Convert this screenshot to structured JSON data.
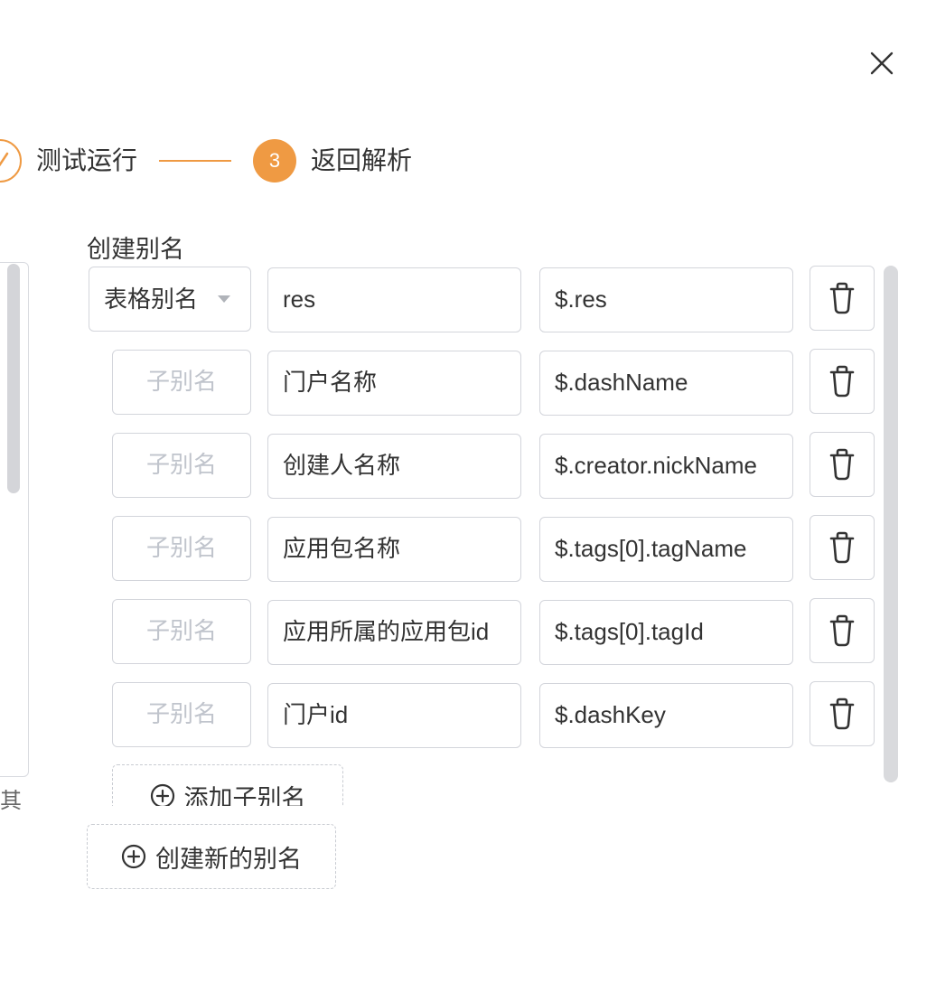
{
  "steps": {
    "done_label": "测试运行",
    "active_number": "3",
    "active_label": "返回解析"
  },
  "left_panel": {
    "truncated_text": "其"
  },
  "section": {
    "title": "创建别名"
  },
  "main_row": {
    "type_select": "表格别名",
    "name": "res",
    "path": "$.res"
  },
  "sub_rows": [
    {
      "alias_placeholder": "子别名",
      "name": "门户名称",
      "path": "$.dashName"
    },
    {
      "alias_placeholder": "子别名",
      "name": "创建人名称",
      "path": "$.creator.nickName"
    },
    {
      "alias_placeholder": "子别名",
      "name": "应用包名称",
      "path": "$.tags[0].tagName"
    },
    {
      "alias_placeholder": "子别名",
      "name": "应用所属的应用包id",
      "path": "$.tags[0].tagId"
    },
    {
      "alias_placeholder": "子别名",
      "name": "门户id",
      "path": "$.dashKey"
    }
  ],
  "actions": {
    "add_sub_alias": "添加子别名",
    "create_new_alias": "创建新的别名"
  },
  "colors": {
    "accent": "#ef9a43",
    "border": "#d3d5db",
    "placeholder": "#c0c4cc"
  },
  "icons": {
    "close": "close-icon",
    "check": "check-icon",
    "delete": "trash-icon",
    "add": "plus-circle-icon",
    "dropdown": "caret-down-icon"
  }
}
